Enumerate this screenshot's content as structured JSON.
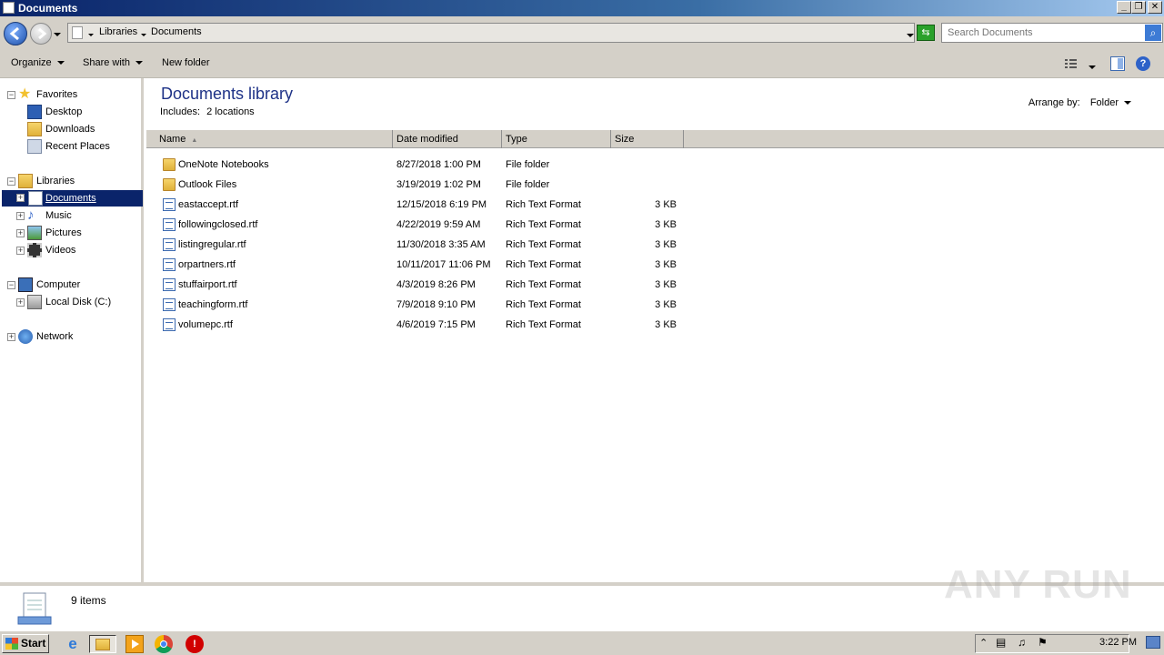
{
  "window": {
    "title": "Documents"
  },
  "address": {
    "crumbs": [
      "Libraries",
      "Documents"
    ],
    "search_placeholder": "Search Documents"
  },
  "toolbar": {
    "organize": "Organize",
    "share_with": "Share with",
    "new_folder": "New folder"
  },
  "nav": {
    "favorites": "Favorites",
    "desktop": "Desktop",
    "downloads": "Downloads",
    "recent_places": "Recent Places",
    "libraries": "Libraries",
    "documents": "Documents",
    "music": "Music",
    "pictures": "Pictures",
    "videos": "Videos",
    "computer": "Computer",
    "local_disk": "Local Disk (C:)",
    "network": "Network"
  },
  "library": {
    "title": "Documents library",
    "includes_label": "Includes:",
    "includes_link": "2 locations",
    "arrange_label": "Arrange by:",
    "arrange_value": "Folder"
  },
  "columns": {
    "name": "Name",
    "date": "Date modified",
    "type": "Type",
    "size": "Size"
  },
  "files": [
    {
      "name": "OneNote Notebooks",
      "date": "8/27/2018 1:00 PM",
      "type": "File folder",
      "size": "",
      "icon": "folder-icon"
    },
    {
      "name": "Outlook Files",
      "date": "3/19/2019 1:02 PM",
      "type": "File folder",
      "size": "",
      "icon": "folder-icon"
    },
    {
      "name": "eastaccept.rtf",
      "date": "12/15/2018 6:19 PM",
      "type": "Rich Text Format",
      "size": "3 KB",
      "icon": "rtf-file-icon"
    },
    {
      "name": "followingclosed.rtf",
      "date": "4/22/2019 9:59 AM",
      "type": "Rich Text Format",
      "size": "3 KB",
      "icon": "rtf-file-icon"
    },
    {
      "name": "listingregular.rtf",
      "date": "11/30/2018 3:35 AM",
      "type": "Rich Text Format",
      "size": "3 KB",
      "icon": "rtf-file-icon"
    },
    {
      "name": "orpartners.rtf",
      "date": "10/11/2017 11:06 PM",
      "type": "Rich Text Format",
      "size": "3 KB",
      "icon": "rtf-file-icon"
    },
    {
      "name": "stuffairport.rtf",
      "date": "4/3/2019 8:26 PM",
      "type": "Rich Text Format",
      "size": "3 KB",
      "icon": "rtf-file-icon"
    },
    {
      "name": "teachingform.rtf",
      "date": "7/9/2018 9:10 PM",
      "type": "Rich Text Format",
      "size": "3 KB",
      "icon": "rtf-file-icon"
    },
    {
      "name": "volumepc.rtf",
      "date": "4/6/2019 7:15 PM",
      "type": "Rich Text Format",
      "size": "3 KB",
      "icon": "rtf-file-icon"
    }
  ],
  "details": {
    "item_count": "9 items"
  },
  "watermark": "ANY RUN",
  "taskbar": {
    "start": "Start",
    "clock": "3:22 PM"
  },
  "colors": {
    "selection": "#0a246a",
    "library_title": "#1e3287",
    "chrome": "#d4d0c8"
  }
}
